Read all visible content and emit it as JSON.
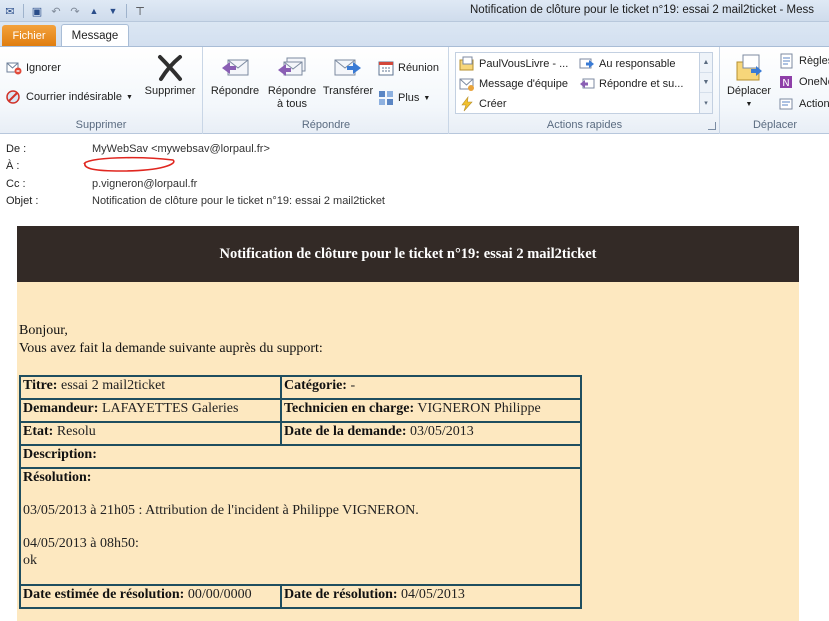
{
  "window": {
    "title": "Notification de clôture pour le ticket n°19: essai 2 mail2ticket  -  Mess",
    "qat": [
      {
        "name": "mail-icon",
        "glyph": "✉"
      },
      {
        "name": "save-icon",
        "glyph": "▣"
      },
      {
        "name": "undo-icon",
        "glyph": "↶"
      },
      {
        "name": "redo-icon",
        "glyph": "↷"
      },
      {
        "name": "up-arrow-icon",
        "glyph": "▲"
      },
      {
        "name": "down-arrow-icon",
        "glyph": "▼"
      },
      {
        "name": "customize-qat-icon",
        "glyph": "⊤"
      }
    ]
  },
  "tabs": {
    "fichier": "Fichier",
    "message": "Message"
  },
  "ribbon": {
    "supprimer": {
      "ignorer": "Ignorer",
      "courrier": "Courrier indésirable",
      "supprimer": "Supprimer",
      "label": "Supprimer"
    },
    "repondre": {
      "repondre": "Répondre",
      "repondre_tous_1": "Répondre",
      "repondre_tous_2": "à tous",
      "transferer": "Transférer",
      "reunion": "Réunion",
      "plus": "Plus",
      "label": "Répondre"
    },
    "actions_rapides": {
      "items": [
        "PaulVousLivre - ...",
        "Au responsable",
        "Message d'équipe",
        "Répondre et su...",
        "Créer"
      ],
      "label": "Actions rapides"
    },
    "deplacer": {
      "deplacer": "Déplacer",
      "regles": "Règles",
      "onenote": "OneNo",
      "actions": "Actions",
      "label": "Déplacer"
    }
  },
  "headers": {
    "de_label": "De :",
    "de_value": "MyWebSav <mywebsav@lorpaul.fr>",
    "a_label": "À :",
    "a_value": "",
    "cc_label": "Cc :",
    "cc_value": "p.vigneron@lorpaul.fr",
    "objet_label": "Objet :",
    "objet_value": "Notification de clôture pour le ticket n°19: essai 2 mail2ticket"
  },
  "email": {
    "banner": "Notification de clôture pour le ticket n°19: essai 2 mail2ticket",
    "greeting": "Bonjour,",
    "intro": "Vous avez fait la demande suivante auprès du support:",
    "titre_label": "Titre:",
    "titre_value": "essai 2 mail2ticket",
    "categorie_label": "Catégorie:",
    "categorie_value": "-",
    "demandeur_label": "Demandeur:",
    "demandeur_value": "LAFAYETTES Galeries",
    "technicien_label": "Technicien en charge:",
    "technicien_value": "VIGNERON Philippe",
    "etat_label": "Etat:",
    "etat_value": "Resolu",
    "date_demande_label": "Date de la demande:",
    "date_demande_value": "03/05/2013",
    "description_label": "Description:",
    "resolution_label": "Résolution:",
    "resolution_line1": "03/05/2013 à 21h05 : Attribution de l'incident à Philippe VIGNERON.",
    "resolution_line2": "04/05/2013 à 08h50:",
    "resolution_line3": "ok",
    "date_estimee_label": "Date estimée de résolution:",
    "date_estimee_value": "00/00/0000",
    "date_resolution_label": "Date de résolution:",
    "date_resolution_value": "04/05/2013"
  }
}
